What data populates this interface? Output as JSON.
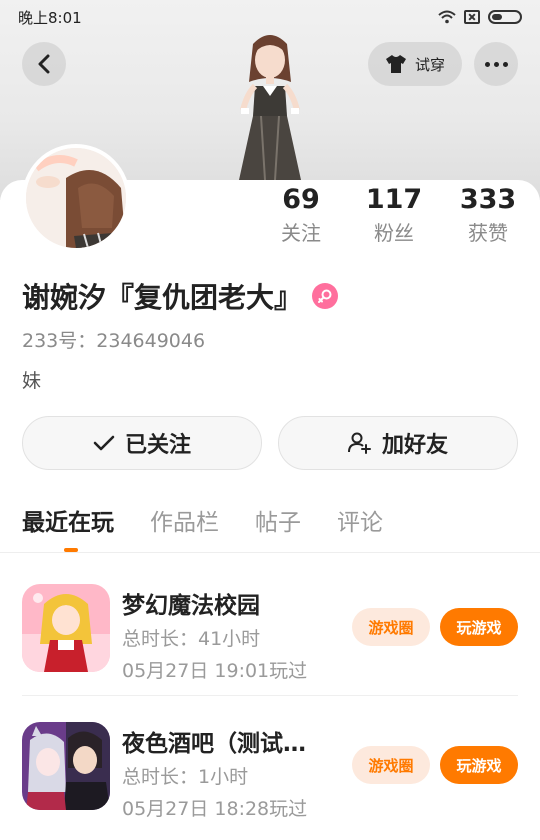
{
  "status_bar": {
    "time": "晚上8:01"
  },
  "header": {
    "tryon_label": "试穿"
  },
  "stats": [
    {
      "value": "69",
      "label": "关注"
    },
    {
      "value": "117",
      "label": "粉丝"
    },
    {
      "value": "333",
      "label": "获赞"
    }
  ],
  "profile": {
    "name": "谢婉汐『复仇团老大』",
    "uid": "233号：234649046",
    "bio": "妹"
  },
  "actions": {
    "follow_label": "已关注",
    "add_friend_label": "加好友"
  },
  "tabs": [
    {
      "label": "最近在玩",
      "active": true
    },
    {
      "label": "作品栏",
      "active": false
    },
    {
      "label": "帖子",
      "active": false
    },
    {
      "label": "评论",
      "active": false
    }
  ],
  "games": [
    {
      "title": "梦幻魔法校园",
      "duration": "总时长：41小时",
      "last_played": "05月27日 19:01玩过",
      "circle_label": "游戏圈",
      "play_label": "玩游戏"
    },
    {
      "title": "夜色酒吧（测试…",
      "duration": "总时长：1小时",
      "last_played": "05月27日 18:28玩过",
      "circle_label": "游戏圈",
      "play_label": "玩游戏"
    }
  ],
  "colors": {
    "accent": "#ff7a00",
    "accent_light": "#fde9dd",
    "female": "#ff6f9d"
  }
}
